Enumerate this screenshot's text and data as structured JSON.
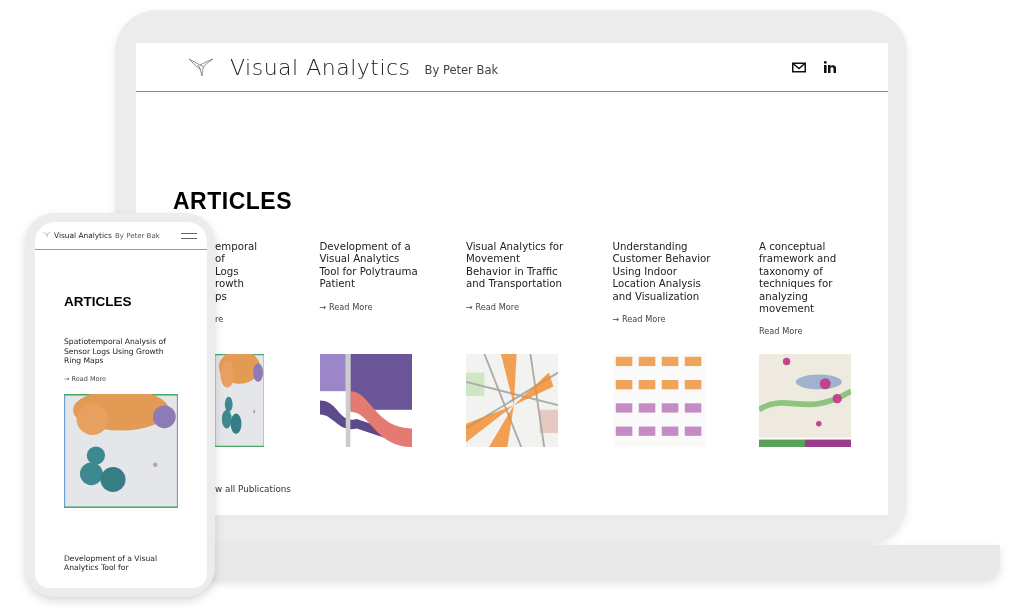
{
  "desktop": {
    "site_title": "Visual Analytics",
    "byline": "By Peter Bak",
    "heading": "ARTICLES",
    "articles": [
      {
        "kind": "partial",
        "title_fragments": [
          "emporal",
          "of",
          "Logs",
          "rowth",
          "ps"
        ],
        "link": "re"
      },
      {
        "kind": "full",
        "title": "Development of a Visual Analytics Tool for Polytrauma Patient",
        "link": "→ Read More"
      },
      {
        "kind": "full",
        "title": "Visual Analytics for Movement Behavior in Traffic and Transportation",
        "link": "→ Read More"
      },
      {
        "kind": "full",
        "title": "Understanding Customer Behavior Using Indoor Location Analysis and Visualization",
        "link": "→ Read More"
      },
      {
        "kind": "full",
        "title": "A conceptual framework and taxonomy of techniques for analyzing movement",
        "link": "Read More"
      }
    ],
    "all_link": "w all Publications"
  },
  "mobile": {
    "site_title": "Visual Analytics",
    "byline": "By Peter Bak",
    "heading": "ARTICLES",
    "articles": [
      {
        "kind": "full",
        "title": "Spatiotemporal Analysis of Sensor Logs Using Growth Ring Maps",
        "link": "→ Read More"
      },
      {
        "kind": "cut",
        "title": "Development of a Visual Analytics Tool for"
      }
    ]
  }
}
